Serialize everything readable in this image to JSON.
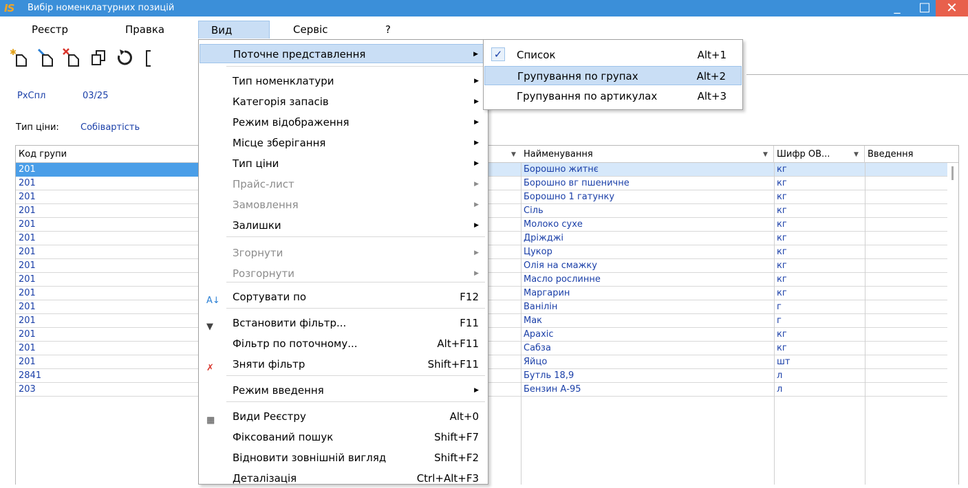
{
  "window": {
    "logo": "IS",
    "title": "Вибір номенклатурних позицій",
    "minimize": "_",
    "maximize": "□",
    "close": "✕"
  },
  "menubar": [
    "Реєстр",
    "Правка",
    "Вид",
    "Сервіс",
    "?"
  ],
  "info": {
    "doc_code": "РхСпл",
    "period": "03/25",
    "price_type_label": "Тип ціни:",
    "price_type_value": "Собівартість"
  },
  "grid": {
    "headers": {
      "group_code": "Код групи",
      "name": "Найменування",
      "unit": "Шифр ОВ...",
      "entered": "Введення"
    },
    "rows": [
      {
        "code": "201",
        "name": "Борошно житнє",
        "unit": "кг"
      },
      {
        "code": "201",
        "name": "Борошно вг пшеничне",
        "unit": "кг"
      },
      {
        "code": "201",
        "name": "Борошно 1 гатунку",
        "unit": "кг"
      },
      {
        "code": "201",
        "name": "Сіль",
        "unit": "кг"
      },
      {
        "code": "201",
        "name": "Молоко сухе",
        "unit": "кг"
      },
      {
        "code": "201",
        "name": "Дріжджі",
        "unit": "кг"
      },
      {
        "code": "201",
        "name": "Цукор",
        "unit": "кг"
      },
      {
        "code": "201",
        "name": "Олія на смажку",
        "unit": "кг"
      },
      {
        "code": "201",
        "name": "Масло рослинне",
        "unit": "кг"
      },
      {
        "code": "201",
        "name": "Маргарин",
        "unit": "кг"
      },
      {
        "code": "201",
        "name": "Ванілін",
        "unit": "г"
      },
      {
        "code": "201",
        "name": "Мак",
        "unit": "г"
      },
      {
        "code": "201",
        "name": "Арахіс",
        "unit": "кг"
      },
      {
        "code": "201",
        "name": "Сабза",
        "unit": "кг"
      },
      {
        "code": "201",
        "name": "Яйцо",
        "unit": "шт"
      },
      {
        "code": "2841",
        "name": "Бутль 18,9",
        "unit": "л"
      },
      {
        "code": "203",
        "name": "Бензин А-95",
        "unit": "л"
      }
    ]
  },
  "view_menu": [
    {
      "label": "Поточне представлення",
      "shortcut": "",
      "submenu": true,
      "disabled": false,
      "highlighted": true,
      "icon": ""
    },
    {
      "label": "Тип номенклатури",
      "shortcut": "",
      "submenu": true,
      "disabled": false,
      "icon": ""
    },
    {
      "label": "Категорія запасів",
      "shortcut": "",
      "submenu": true,
      "disabled": false,
      "icon": ""
    },
    {
      "label": "Режим відображення",
      "shortcut": "",
      "submenu": true,
      "disabled": false,
      "icon": ""
    },
    {
      "label": "Місце зберігання",
      "shortcut": "",
      "submenu": true,
      "disabled": false,
      "icon": ""
    },
    {
      "label": "Тип ціни",
      "shortcut": "",
      "submenu": true,
      "disabled": false,
      "icon": ""
    },
    {
      "label": "Прайс-лист",
      "shortcut": "",
      "submenu": true,
      "disabled": true,
      "icon": ""
    },
    {
      "label": "Замовлення",
      "shortcut": "",
      "submenu": true,
      "disabled": true,
      "icon": ""
    },
    {
      "label": "Залишки",
      "shortcut": "",
      "submenu": true,
      "disabled": false,
      "icon": ""
    },
    {
      "label": "Згорнути",
      "shortcut": "",
      "submenu": true,
      "disabled": true,
      "icon": ""
    },
    {
      "label": "Розгорнути",
      "shortcut": "",
      "submenu": true,
      "disabled": true,
      "icon": ""
    },
    {
      "label": "Сортувати по",
      "shortcut": "F12",
      "submenu": false,
      "disabled": false,
      "icon": "sort-az-icon"
    },
    {
      "label": "Встановити фільтр...",
      "shortcut": "F11",
      "submenu": false,
      "disabled": false,
      "icon": "filter-icon"
    },
    {
      "label": "Фільтр по поточному...",
      "shortcut": "Alt+F11",
      "submenu": false,
      "disabled": false,
      "icon": ""
    },
    {
      "label": "Зняти фільтр",
      "shortcut": "Shift+F11",
      "submenu": false,
      "disabled": false,
      "icon": "remove-filter-icon"
    },
    {
      "label": "Режим введення",
      "shortcut": "",
      "submenu": true,
      "disabled": false,
      "icon": ""
    },
    {
      "label": "Види Реєстру",
      "shortcut": "Alt+0",
      "submenu": false,
      "disabled": false,
      "icon": "table-grid-icon"
    },
    {
      "label": "Фіксований пошук",
      "shortcut": "Shift+F7",
      "submenu": false,
      "disabled": false,
      "icon": ""
    },
    {
      "label": "Відновити зовнішній вигляд",
      "shortcut": "Shift+F2",
      "submenu": false,
      "disabled": false,
      "icon": ""
    },
    {
      "label": "Деталізація",
      "shortcut": "Ctrl+Alt+F3",
      "submenu": false,
      "disabled": false,
      "icon": ""
    }
  ],
  "submenu": [
    {
      "label": "Список",
      "shortcut": "Alt+1",
      "checked": true
    },
    {
      "label": "Групування по групах",
      "shortcut": "Alt+2",
      "checked": false,
      "highlighted": true
    },
    {
      "label": "Групування по артикулах",
      "shortcut": "Alt+3",
      "checked": false
    }
  ],
  "check_mark": "✓",
  "submenu_arrow": "▶",
  "sort_arrow": "▼",
  "colors": {
    "title_bar": "#3b8fd9",
    "link_blue": "#1a3fa8",
    "highlight": "#c9def5",
    "selected_cell": "#4a9ee8"
  }
}
